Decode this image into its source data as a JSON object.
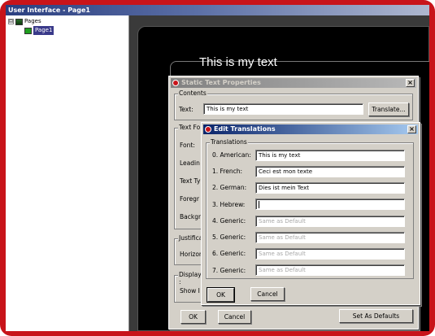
{
  "window": {
    "title": "User Interface - Page1"
  },
  "tree": {
    "items": [
      {
        "label": "Pages",
        "expander": "⊟",
        "icon": "pages-icon"
      },
      {
        "label": "Page1",
        "icon": "page-icon"
      }
    ]
  },
  "canvas": {
    "text": "This is my text"
  },
  "static_text_dialog": {
    "title": "Static Text Properties",
    "contents_group": "Contents",
    "text_label": "Text:",
    "text_value": "This is my text",
    "translate_button": "Translate...",
    "text_format_group": "Text Fo",
    "font_label": "Font:",
    "leading_label": "Leadin",
    "text_type_label": "Text Ty",
    "foreground_label": "Foregr",
    "background_label": "Backgr",
    "justification_group": "Justifica",
    "horizontal_label": "Horizon",
    "display_group": "Display :",
    "show_label": "Show I",
    "ok_button": "OK",
    "cancel_button": "Cancel",
    "set_defaults_button": "Set As Defaults"
  },
  "edit_translations_dialog": {
    "title": "Edit Translations",
    "group_label": "Translations",
    "rows": [
      {
        "label": "0. American:",
        "value": "This is my text",
        "placeholder": ""
      },
      {
        "label": "1. French:",
        "value": "Ceci est mon texte",
        "placeholder": ""
      },
      {
        "label": "2. German:",
        "value": "Dies ist mein Text",
        "placeholder": ""
      },
      {
        "label": "3. Hebrew:",
        "value": "",
        "placeholder": ""
      },
      {
        "label": "4. Generic:",
        "value": "",
        "placeholder": "Same as Default"
      },
      {
        "label": "5. Generic:",
        "value": "",
        "placeholder": "Same as Default"
      },
      {
        "label": "6. Generic:",
        "value": "",
        "placeholder": "Same as Default"
      },
      {
        "label": "7. Generic:",
        "value": "",
        "placeholder": "Same as Default"
      }
    ],
    "ok_button": "OK",
    "cancel_button": "Cancel"
  },
  "colors": {
    "frame": "#c8141a",
    "active_title": "#0a246a",
    "dialog_face": "#d4d0c8"
  }
}
